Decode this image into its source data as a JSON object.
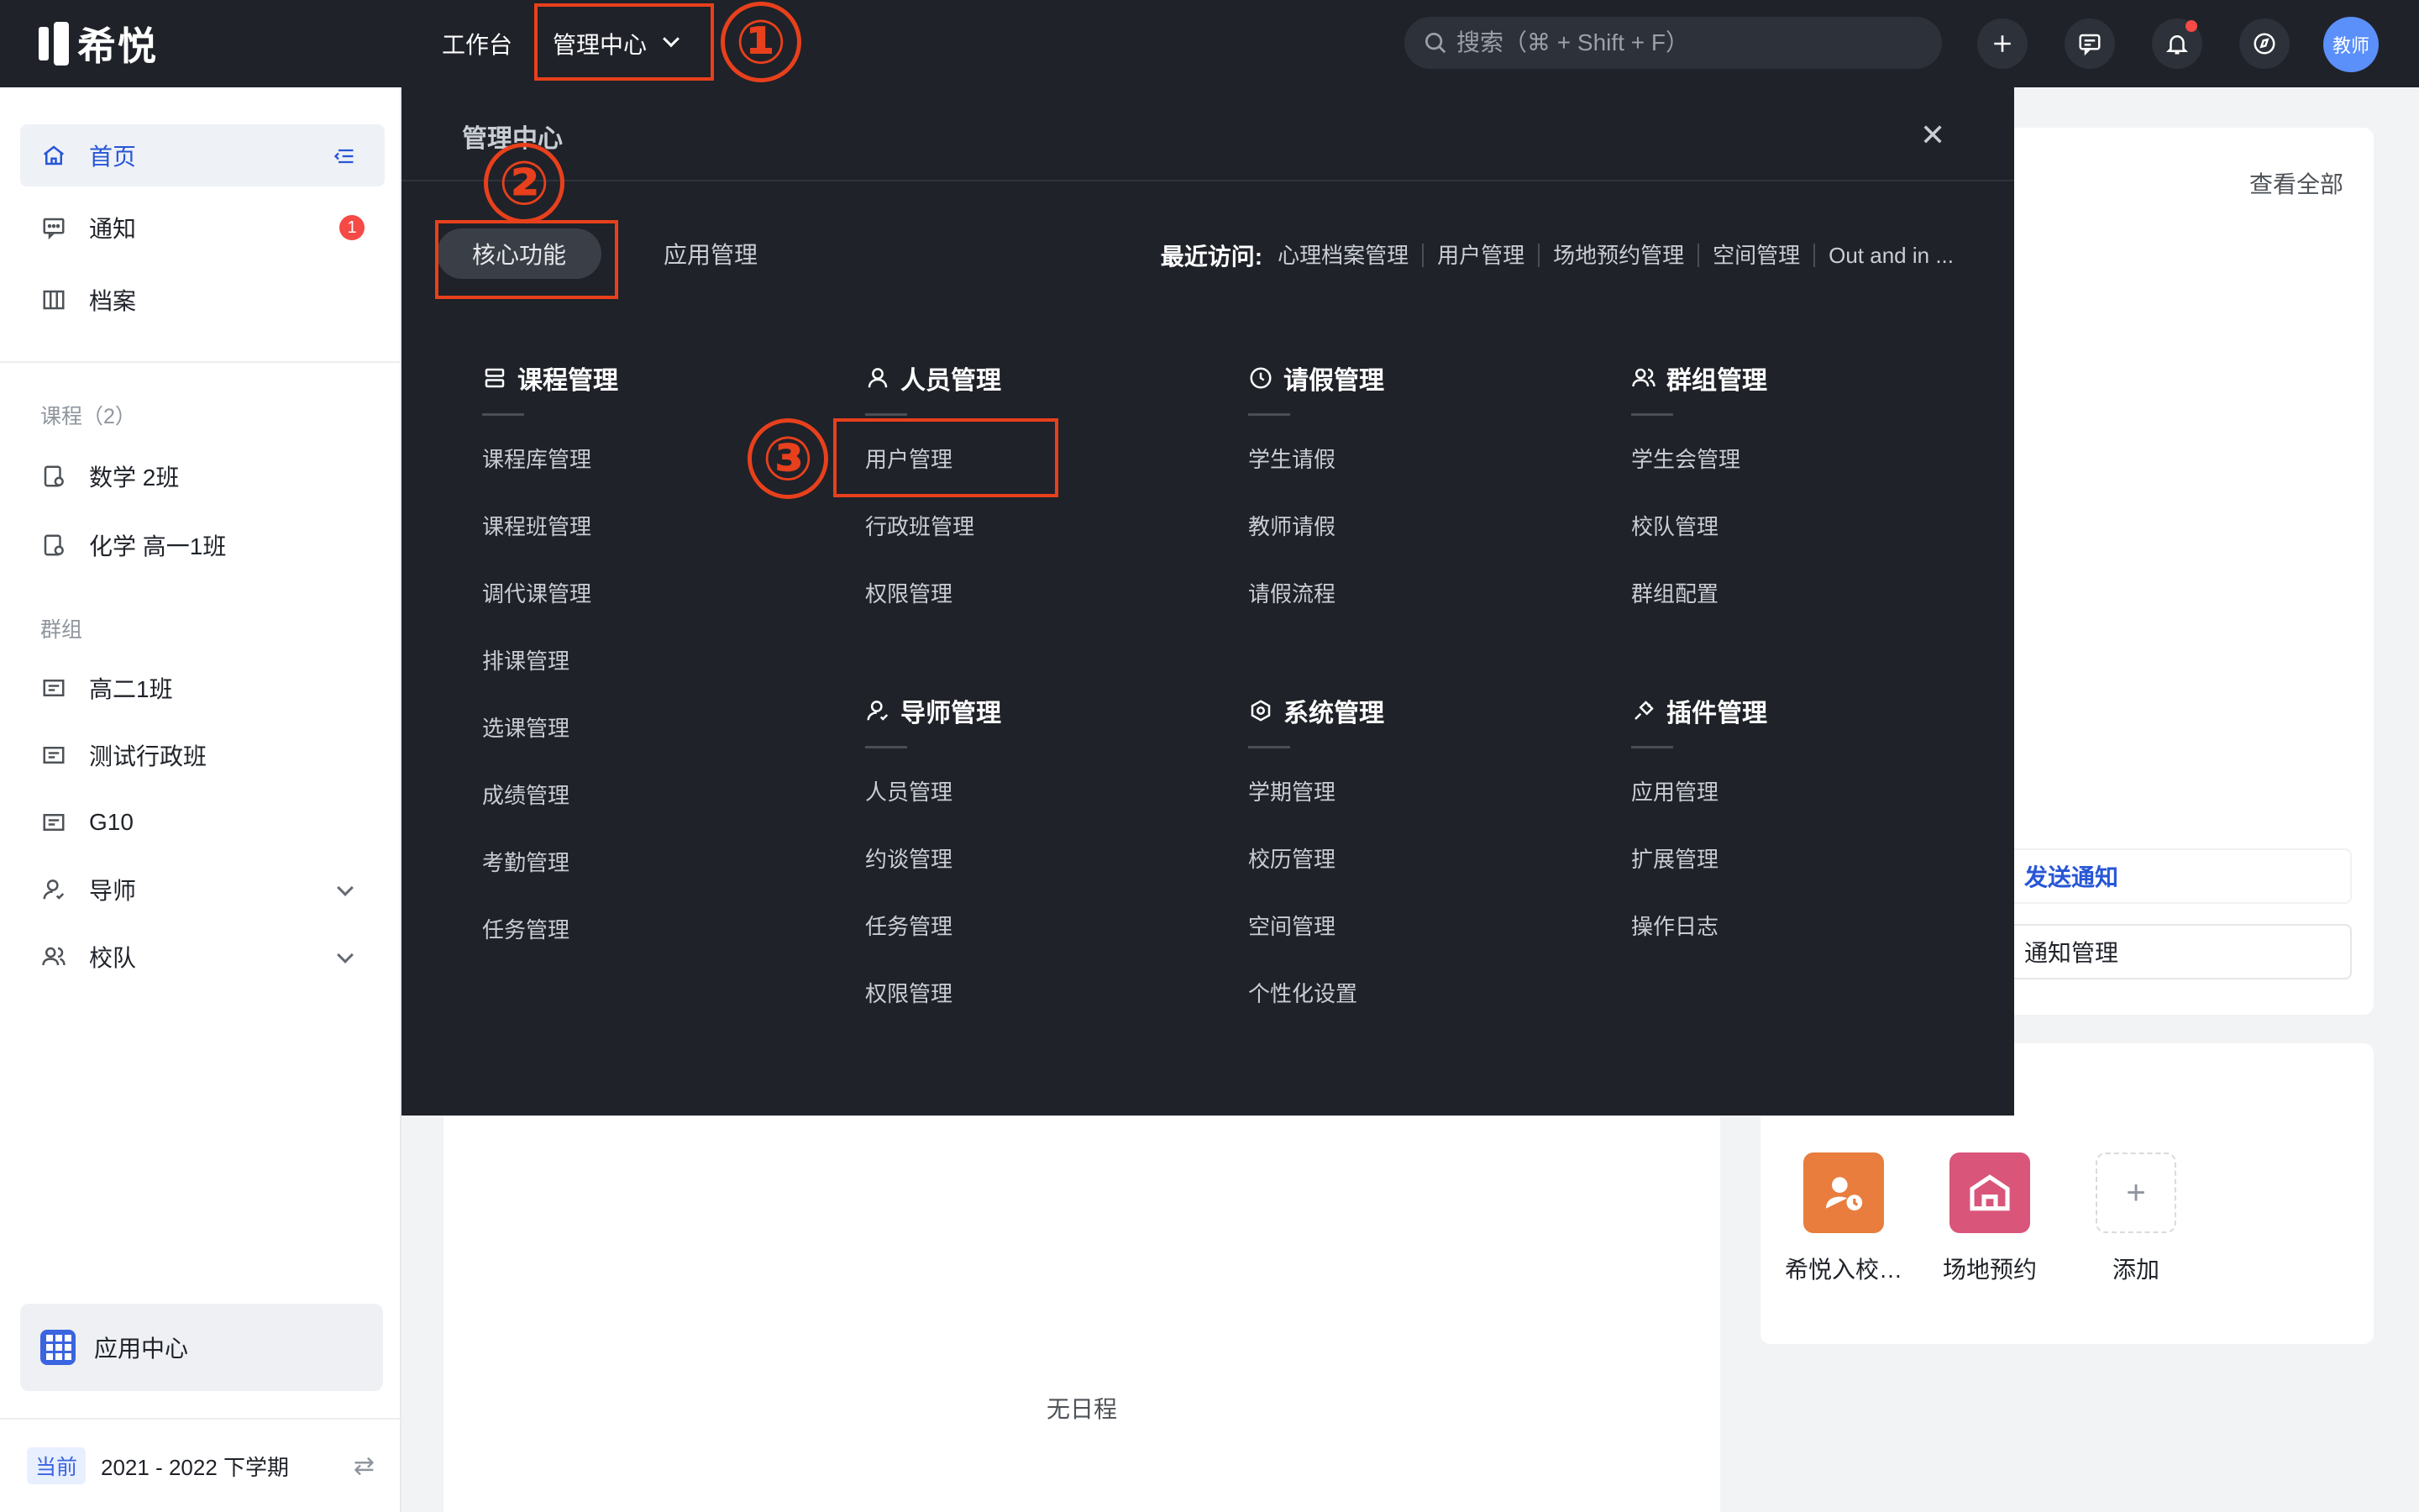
{
  "topbar": {
    "logo_text": "希悦",
    "nav": {
      "workbench": "工作台",
      "admin_center": "管理中心"
    },
    "search": {
      "placeholder": "搜索（⌘ + Shift + F）"
    },
    "avatar_text": "教师"
  },
  "sidebar": {
    "home": "首页",
    "notice": "通知",
    "notice_badge": "1",
    "archive": "档案",
    "courses_section": "课程（2）",
    "courses": [
      "数学 2班",
      "化学 高一1班"
    ],
    "groups_section": "群组",
    "groups": [
      "高二1班",
      "测试行政班",
      "G10"
    ],
    "mentor": "导师",
    "team": "校队",
    "app_center": "应用中心",
    "term_tag": "当前",
    "term": "2021 - 2022 下学期"
  },
  "main": {
    "no_schedule": "无日程",
    "view_all": "查看全部",
    "send_notice": "发送通知",
    "notice_mgmt": "通知管理",
    "apps": [
      "希悦入校…",
      "场地预约",
      "添加"
    ]
  },
  "panel": {
    "title": "管理中心",
    "tabs": {
      "core": "核心功能",
      "apps": "应用管理"
    },
    "recent_label": "最近访问:",
    "recent_links": [
      "心理档案管理",
      "用户管理",
      "场地预约管理",
      "空间管理",
      "Out and in ..."
    ],
    "groups": {
      "course": {
        "title": "课程管理",
        "items": [
          "课程库管理",
          "课程班管理",
          "调代课管理",
          "排课管理",
          "选课管理",
          "成绩管理",
          "考勤管理",
          "任务管理"
        ]
      },
      "people": {
        "title": "人员管理",
        "items": [
          "用户管理",
          "行政班管理",
          "权限管理"
        ]
      },
      "leave": {
        "title": "请假管理",
        "items": [
          "学生请假",
          "教师请假",
          "请假流程"
        ]
      },
      "group": {
        "title": "群组管理",
        "items": [
          "学生会管理",
          "校队管理",
          "群组配置"
        ]
      },
      "mentor": {
        "title": "导师管理",
        "items": [
          "人员管理",
          "约谈管理",
          "任务管理",
          "权限管理"
        ]
      },
      "system": {
        "title": "系统管理",
        "items": [
          "学期管理",
          "校历管理",
          "空间管理",
          "个性化设置"
        ]
      },
      "plugin": {
        "title": "插件管理",
        "items": [
          "应用管理",
          "扩展管理",
          "操作日志"
        ]
      }
    }
  },
  "annotations": {
    "step1": "①",
    "step2": "②",
    "step3": "③"
  },
  "colors": {
    "topbar": "#1f2229",
    "accent": "#2756d6",
    "annotation_red": "#e8401c",
    "badge_red": "#f54a45"
  }
}
